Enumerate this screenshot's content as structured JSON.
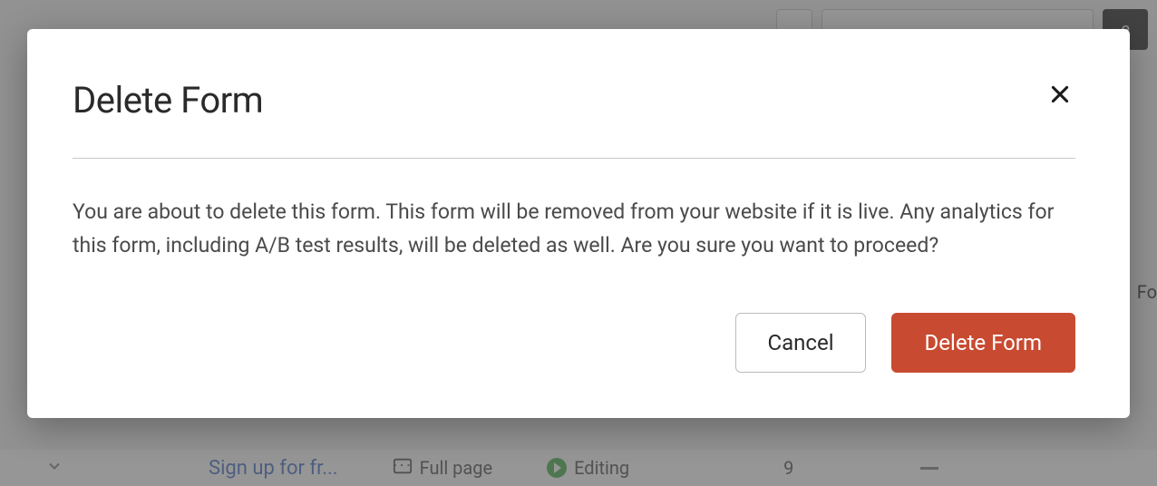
{
  "modal": {
    "title": "Delete Form",
    "body": "You are about to delete this form. This form will be removed from your website if it is live. Any analytics for this form, including A/B test results, will be deleted as well. Are you sure you want to proceed?",
    "cancel_label": "Cancel",
    "confirm_label": "Delete Form"
  },
  "background": {
    "link_text": "Sign up for fr...",
    "fullpage_label": "Full page",
    "status_label": "Editing",
    "count": "9",
    "side_text": "Fo",
    "top_button_text": "e"
  }
}
